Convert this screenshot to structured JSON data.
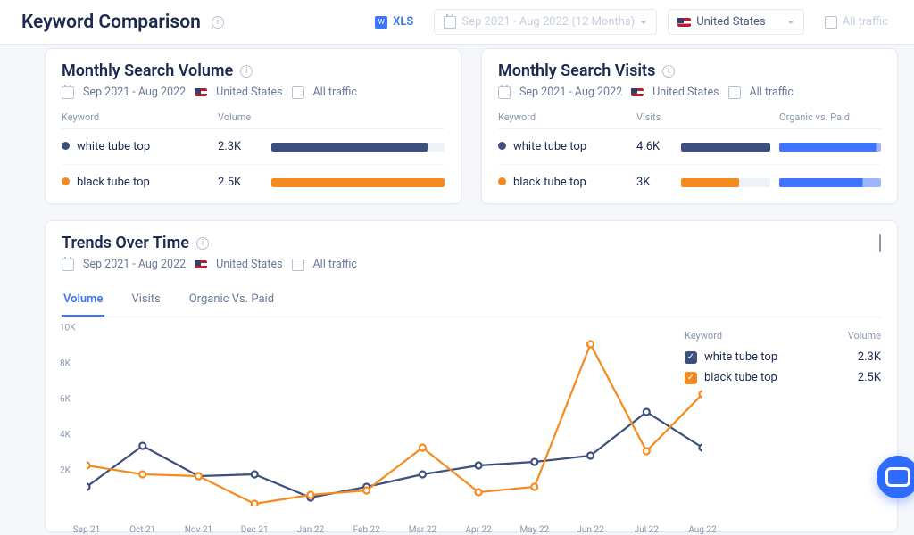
{
  "header": {
    "title": "Keyword Comparison",
    "xls_label": "XLS",
    "date_range_display": "Sep 2021 - Aug 2022 (12 Months)",
    "country": "United States",
    "traffic_filter": "All traffic"
  },
  "volume_card": {
    "title": "Monthly Search Volume",
    "date_range": "Sep 2021 - Aug 2022",
    "country": "United States",
    "traffic": "All traffic",
    "headers": {
      "keyword": "Keyword",
      "volume": "Volume"
    },
    "rows": [
      {
        "color": "#3d4f7d",
        "keyword": "white tube top",
        "volume_display": "2.3K",
        "bar_percent": 90
      },
      {
        "color": "#f58a1f",
        "keyword": "black tube top",
        "volume_display": "2.5K",
        "bar_percent": 100
      }
    ]
  },
  "visits_card": {
    "title": "Monthly Search Visits",
    "date_range": "Sep 2021 - Aug 2022",
    "country": "United States",
    "traffic": "All traffic",
    "headers": {
      "keyword": "Keyword",
      "visits": "Visits",
      "ovp": "Organic vs. Paid"
    },
    "rows": [
      {
        "color": "#3d4f7d",
        "keyword": "white tube top",
        "visits_display": "4.6K",
        "bar_percent": 100,
        "organic_percent": 95
      },
      {
        "color": "#f58a1f",
        "keyword": "black tube top",
        "visits_display": "3K",
        "bar_percent": 65,
        "organic_percent": 82
      }
    ]
  },
  "trends_card": {
    "title": "Trends Over Time",
    "date_range": "Sep 2021 - Aug 2022",
    "country": "United States",
    "traffic": "All traffic",
    "tabs": [
      "Volume",
      "Visits",
      "Organic Vs. Paid"
    ],
    "active_tab": "Volume",
    "legend": {
      "headers": {
        "keyword": "Keyword",
        "volume": "Volume"
      },
      "items": [
        {
          "color": "#3d4f7d",
          "label": "white tube top",
          "value": "2.3K"
        },
        {
          "color": "#f58a1f",
          "label": "black tube top",
          "value": "2.5K"
        }
      ]
    }
  },
  "chart_data": {
    "type": "line",
    "xlabel": "",
    "ylabel": "",
    "ylim": [
      0,
      10000
    ],
    "yticks": [
      2000,
      4000,
      6000,
      8000,
      10000
    ],
    "ytick_labels": [
      "2K",
      "4K",
      "6K",
      "8K",
      "10K"
    ],
    "categories": [
      "Sep 21",
      "Oct 21",
      "Nov 21",
      "Dec 21",
      "Jan 22",
      "Feb 22",
      "Mar 22",
      "Apr 22",
      "May 22",
      "Jun 22",
      "Jul 22",
      "Aug 22"
    ],
    "series": [
      {
        "name": "white tube top",
        "color": "#3d4f7d",
        "values": [
          1100,
          3400,
          1700,
          1800,
          500,
          1100,
          1800,
          2300,
          2500,
          2850,
          5300,
          3300
        ]
      },
      {
        "name": "black tube top",
        "color": "#f58a1f",
        "values": [
          2300,
          1800,
          1700,
          150,
          650,
          900,
          3300,
          800,
          1100,
          9100,
          3100,
          6300
        ]
      }
    ]
  }
}
